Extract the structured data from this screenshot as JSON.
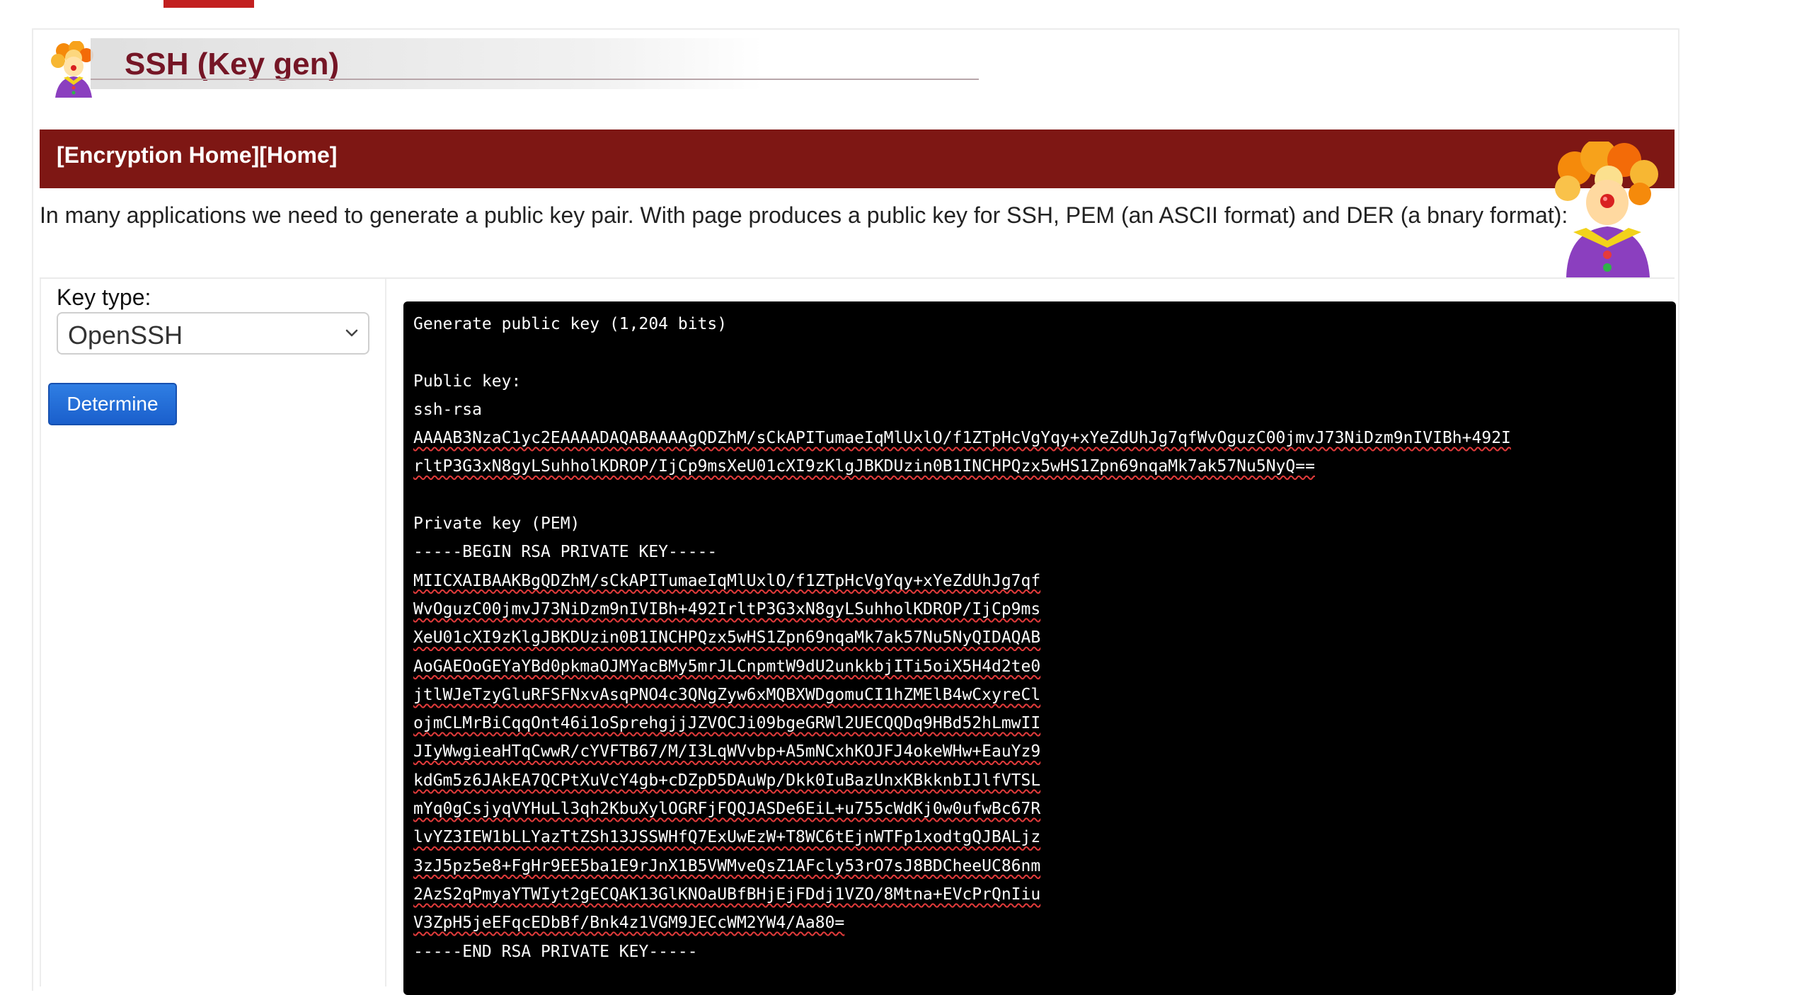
{
  "header": {
    "title": "SSH (Key gen)",
    "logo_icon": "clown-icon"
  },
  "nav": {
    "encryption_home": "[Encryption Home]",
    "home": "[Home]"
  },
  "intro": "In many applications we need to generate a public key pair. With page produces a public key for SSH, PEM (an ASCII format) and DER (a bnary format):",
  "form": {
    "key_type_label": "Key type:",
    "key_type_value": "OpenSSH",
    "determine_label": "Determine"
  },
  "output": {
    "header": "Generate public key (1,204 bits)",
    "public_key_label": "Public key:",
    "public_key_type": "ssh-rsa",
    "public_key_lines": [
      "AAAAB3NzaC1yc2EAAAADAQABAAAAgQDZhM/sCkAPITumaeIqMlUxlO/f1ZTpHcVgYqy+xYeZdUhJg7qfWvOguzC00jmvJ73NiDzm9nIVIBh+492I",
      "rltP3G3xN8gyLSuhholKDROP/IjCp9msXeU01cXI9zKlgJBKDUzin0B1INCHPQzx5wHS1Zpn69nqaMk7ak57Nu5NyQ=="
    ],
    "private_key_label": "Private key (PEM)",
    "begin_marker": "-----BEGIN RSA PRIVATE KEY-----",
    "private_key_lines": [
      "MIICXAIBAAKBgQDZhM/sCkAPITumaeIqMlUxlO/f1ZTpHcVgYqy+xYeZdUhJg7qf",
      "WvOguzC00jmvJ73NiDzm9nIVIBh+492IrltP3G3xN8gyLSuhholKDROP/IjCp9ms",
      "XeU01cXI9zKlgJBKDUzin0B1INCHPQzx5wHS1Zpn69nqaMk7ak57Nu5NyQIDAQAB",
      "AoGAEOoGEYaYBd0pkmaOJMYacBMy5mrJLCnpmtW9dU2unkkbjITi5oiX5H4d2te0",
      "jtlWJeTzyGluRFSFNxvAsqPNO4c3QNgZyw6xMQBXWDgomuCI1hZMElB4wCxyreCl",
      "ojmCLMrBiCqqOnt46i1oSprehgjjJZVOCJi09bgeGRWl2UECQQDq9HBd52hLmwII",
      "JIyWwgieaHTqCwwR/cYVFTB67/M/I3LqWVvbp+A5mNCxhKOJFJ4okeWHw+EauYz9",
      "kdGm5z6JAkEA7QCPtXuVcY4gb+cDZpD5DAuWp/Dkk0IuBazUnxKBkknbIJlfVTSL",
      "mYq0gCsjyqVYHuLl3qh2KbuXylOGRFjFQQJASDe6EiL+u755cWdKj0w0ufwBc67R",
      "lvYZ3IEW1bLLYazTtZSh13JSSWHfQ7ExUwEzW+T8WC6tEjnWTFp1xodtgQJBALjz",
      "3zJ5pz5e8+FgHr9EE5ba1E9rJnX1B5VWMveQsZ1AFcly53rO7sJ8BDCheeUC86nm",
      "2AzS2qPmyaYTWIyt2gECQAK13GlKNOaUBfBHjEjFDdj1VZO/8Mtna+EVcPrQnIiu",
      "V3ZpH5jeEFqcEDbBf/Bnk4z1VGM9JECcWM2YW4/Aa80="
    ],
    "end_marker": "-----END RSA PRIVATE KEY-----"
  }
}
